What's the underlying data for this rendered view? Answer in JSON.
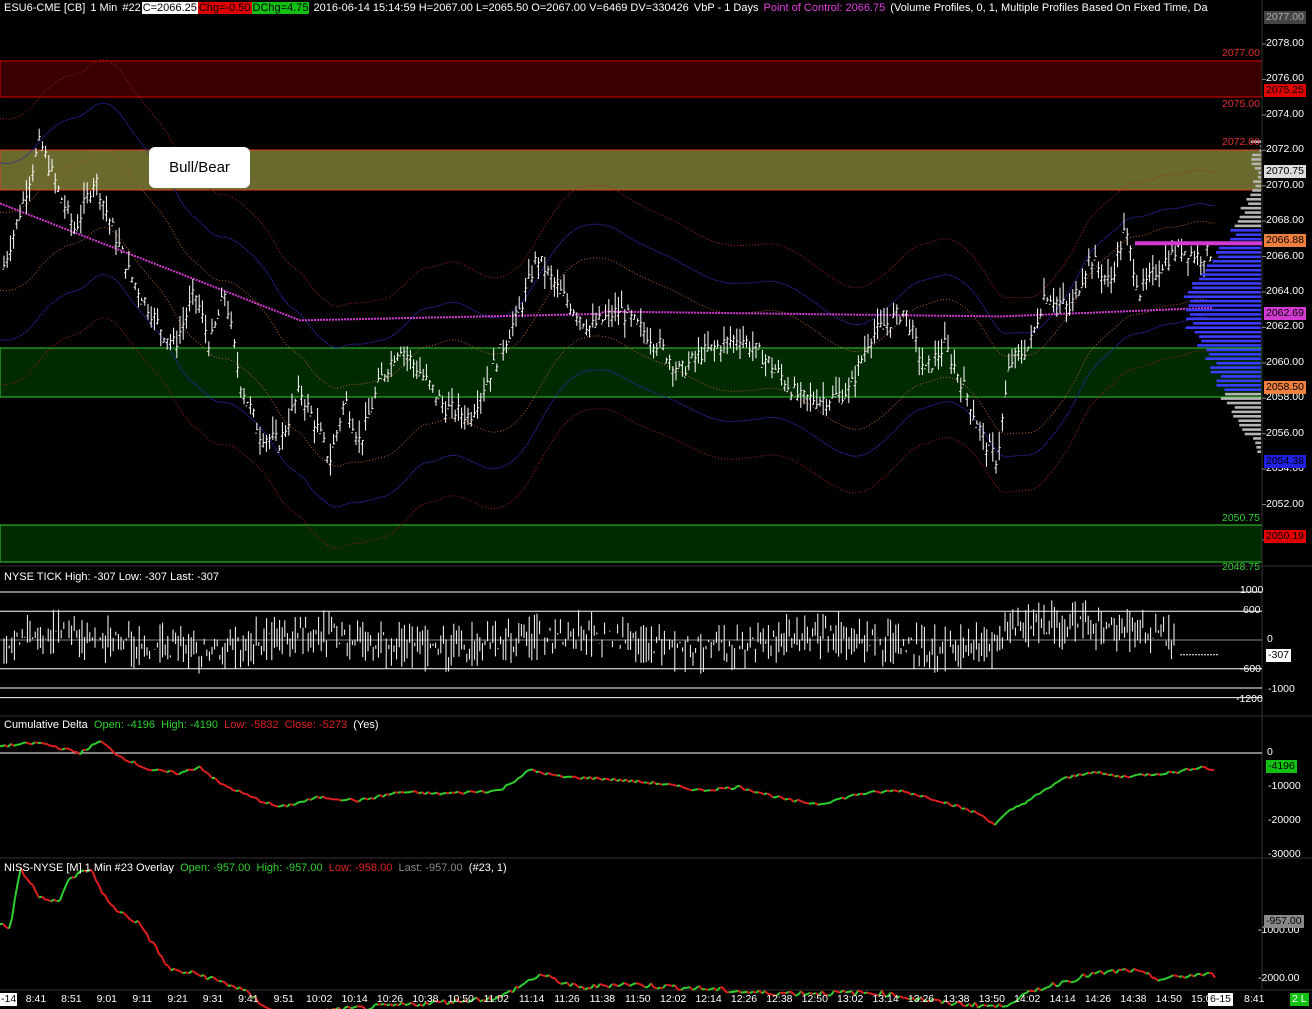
{
  "header": {
    "symbol": "ESU6-CME [CB]",
    "interval": "1 Min",
    "chart_no": "#22",
    "close": "C=2066.25",
    "chg": "Chg=-0.50",
    "dchg": "DChg=4.75",
    "stats": "2016-06-14 15:14:59 H=2067.00 L=2065.50 O=2067.00 V=6469 DV=330426",
    "vbp": "VbP - 1 Days",
    "poc": "Point of Control: 2066.75",
    "profile": "(Volume Profiles, 0, 1, Multiple Profiles Based On Fixed Time, Da"
  },
  "callout": "Bull/Bear",
  "price_axis": {
    "ticks": [
      "2078.00",
      "2076.00",
      "2074.00",
      "2072.00",
      "2070.00",
      "2068.00",
      "2066.00",
      "2064.00",
      "2062.00",
      "2060.00",
      "2058.00",
      "2056.00",
      "2054.00",
      "2052.00",
      "2050.00"
    ],
    "tags": {
      "top": "2077.00",
      "r1": "2075.25",
      "zone_label1": "2077.00",
      "zone_label2": "2075.00",
      "zone_label3": "2072.00",
      "z_top": "2070.75",
      "price": "2066.88",
      "poc": "2062.69",
      "low_orange": "2058.50",
      "blue_bottom": "2054.38",
      "g_label": "2050.75",
      "red_bottom": "2050.19",
      "g_label2": "2048.75"
    }
  },
  "tick_panel": {
    "title": "NYSE TICK  High: -307  Low: -307  Last: -307",
    "ticks": [
      "1000",
      "600",
      "0",
      "-600",
      "-1000",
      "-1200"
    ],
    "last": "-307"
  },
  "delta_panel": {
    "title": "Cumulative Delta",
    "open": "Open: -4196",
    "high": "High: -4190",
    "low": "Low: -5832",
    "close": "Close: -5273",
    "yes": "(Yes)",
    "ticks": [
      "0",
      "-10000",
      "-20000",
      "-30000"
    ],
    "last": "-4196"
  },
  "niss_panel": {
    "title": "NISS-NYSE [M]  1 Min  #23 Overlay",
    "open": "Open: -957.00",
    "high": "High: -957.00",
    "low": "Low: -958.00",
    "last": "Last: -957.00",
    "params": "(#23, 1)",
    "ticks": [
      "-1000.00",
      "-2000.00"
    ],
    "last_tag": "-957.00"
  },
  "time_axis": {
    "labels": [
      "8:41",
      "8:51",
      "9:01",
      "9:11",
      "9:21",
      "9:31",
      "9:41",
      "9:51",
      "10:02",
      "10:14",
      "10:26",
      "10:38",
      "10:50",
      "11:02",
      "11:14",
      "11:26",
      "11:38",
      "11:50",
      "12:02",
      "12:14",
      "12:26",
      "12:38",
      "12:50",
      "13:02",
      "13:14",
      "13:26",
      "13:38",
      "13:50",
      "14:02",
      "14:14",
      "14:26",
      "14:38",
      "14:50",
      "15:02"
    ],
    "left_stub": "-14",
    "date_tag": "6-15",
    "right_time": "8:41",
    "corner": "2 L"
  },
  "colors": {
    "background": "#000000",
    "red_zone": "#3a0000",
    "yellow_zone": "#6b6a2e",
    "green_zone": "#002a00",
    "poc_line": "#d23ad2",
    "vp_blue": "#3c3cff",
    "vp_gray": "#b4b4b4",
    "up_green": "#2fd02f",
    "down_red": "#e02020"
  }
}
